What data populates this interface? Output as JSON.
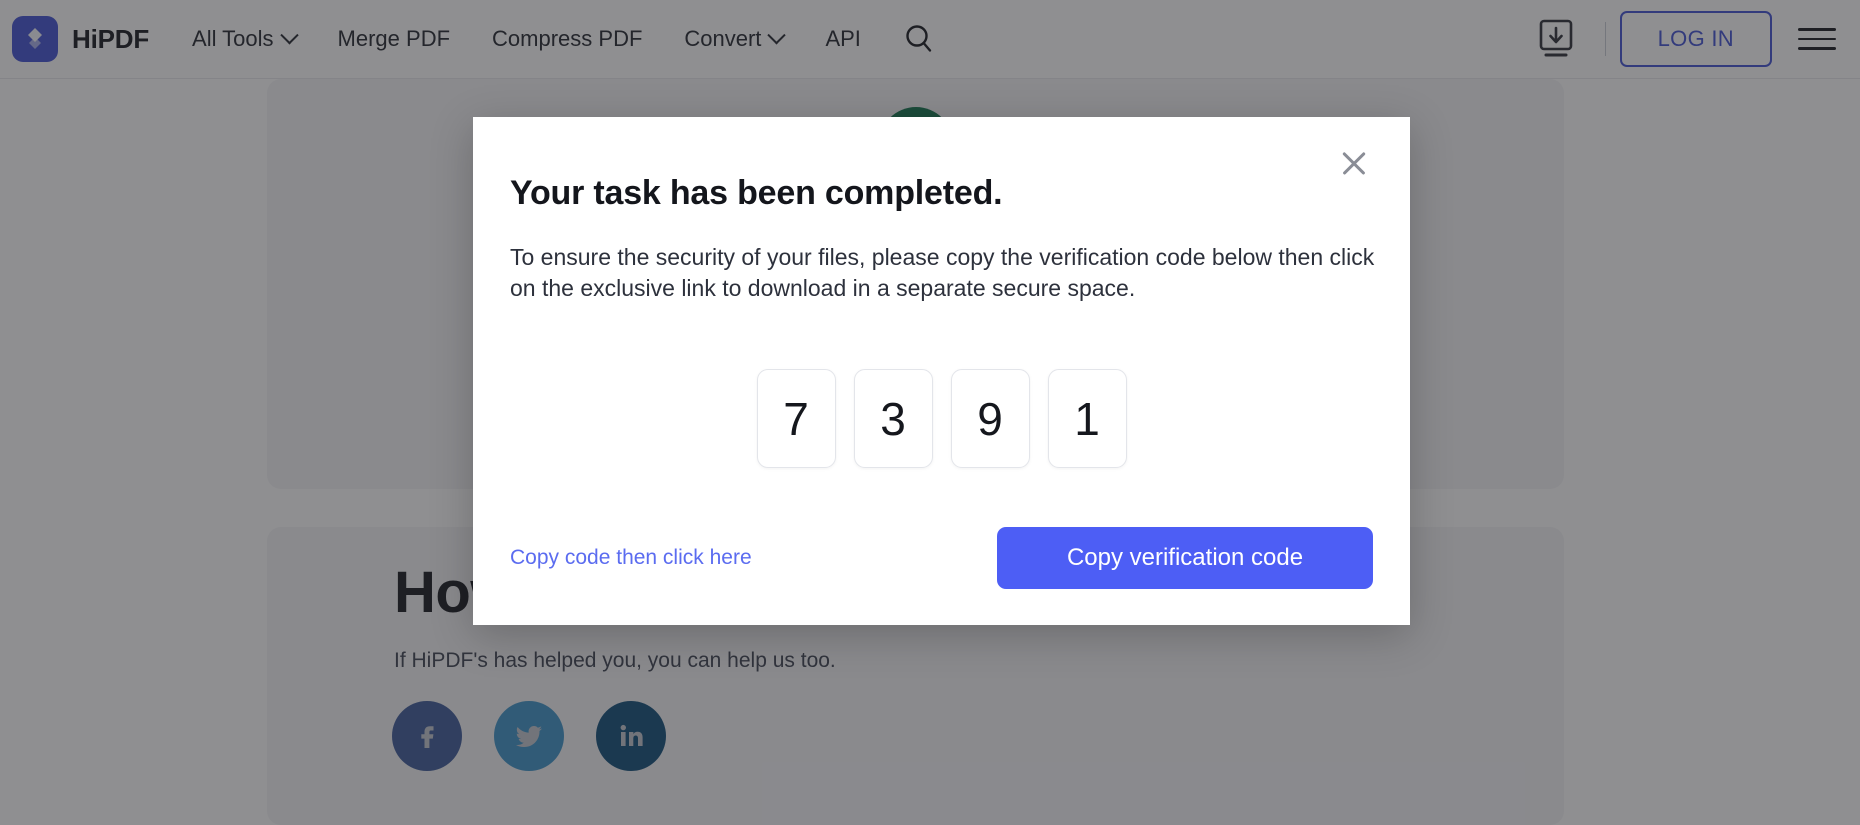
{
  "header": {
    "logo_icon": "hipdf-diamond-logo",
    "brand": "HiPDF",
    "nav": [
      {
        "label": "All Tools",
        "has_caret": true
      },
      {
        "label": "Merge PDF",
        "has_caret": false
      },
      {
        "label": "Compress PDF",
        "has_caret": false
      },
      {
        "label": "Convert",
        "has_caret": true
      },
      {
        "label": "API",
        "has_caret": false
      }
    ],
    "search_icon": "search-icon",
    "download_icon": "download-icon",
    "login_label": "LOG IN",
    "menu_icon": "hamburger-menu-icon"
  },
  "page": {
    "success_icon": "green-check-circle-icon",
    "share_heading": "How",
    "share_sub": "If HiPDF's has helped you, you can help us too.",
    "socials": [
      {
        "name": "facebook",
        "glyph": "f",
        "color": "#3b5998"
      },
      {
        "name": "twitter",
        "glyph": "t",
        "color": "#3c93c8"
      },
      {
        "name": "linkedin",
        "glyph": "in",
        "color": "#0e4b78"
      }
    ]
  },
  "modal": {
    "close_icon": "close-icon",
    "title": "Your task has been completed.",
    "body": "To ensure the security of your files, please copy the verification code below then click on the exclusive link to download in a separate secure space.",
    "code_digits": [
      "7",
      "3",
      "9",
      "1"
    ],
    "code_value": "7391",
    "link_label": "Copy code then click here",
    "primary_label": "Copy verification code"
  },
  "colors": {
    "brand_blue": "#3f51d4",
    "primary_button": "#4d5ef5",
    "link_blue": "#5b6cf0",
    "success_green": "#10744c",
    "overlay": "rgba(40,40,45,0.52)"
  }
}
